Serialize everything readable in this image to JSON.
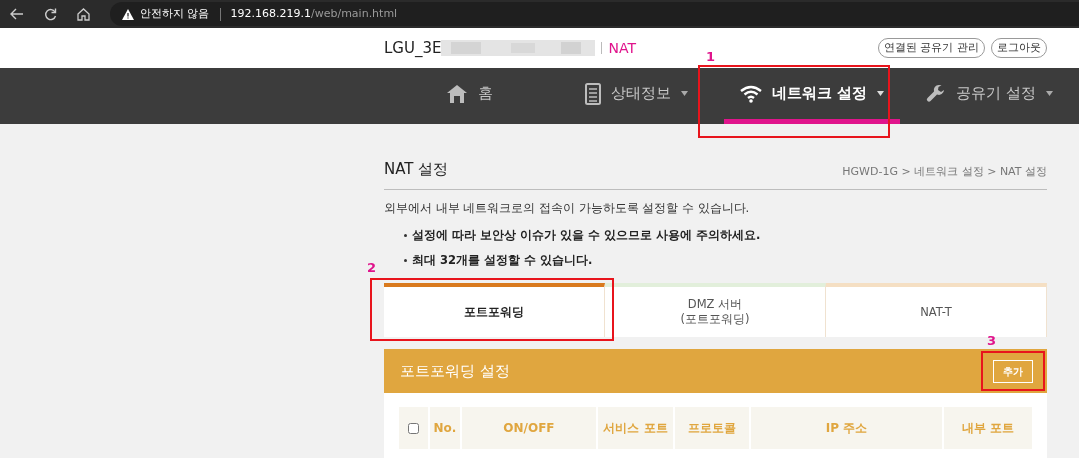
{
  "browser": {
    "security": "안전하지 않음",
    "url_host": "192.168.219.1",
    "url_path": "/web/main.html"
  },
  "header": {
    "ssid": "LGU_3E",
    "mode": "NAT",
    "buttons": [
      "연결된 공유기 관리",
      "로그아웃"
    ]
  },
  "nav": [
    {
      "label": "홈",
      "dropdown": false,
      "selected": false
    },
    {
      "label": "상태정보",
      "dropdown": true,
      "selected": false
    },
    {
      "label": "네트워크 설정",
      "dropdown": true,
      "selected": true
    },
    {
      "label": "공유기 설정",
      "dropdown": true,
      "selected": false
    }
  ],
  "page": {
    "title": "NAT 설정",
    "breadcrumb": "HGWD-1G > 네트워크 설정 > NAT 설정",
    "description": "외부에서 내부 네트워크로의 접속이 가능하도록 설정할 수 있습니다.",
    "notes": [
      "설정에 따라 보안상 이슈가 있을 수 있으므로 사용에 주의하세요.",
      "최대 32개를 설정할 수 있습니다."
    ]
  },
  "tabs": [
    {
      "label": "포트포워딩",
      "selected": true,
      "color": "#d97a1e"
    },
    {
      "label": "DMZ 서버\n(포트포워딩)",
      "selected": false,
      "color": "#e2efdb"
    },
    {
      "label": "NAT-T",
      "selected": false,
      "color": "#f5dfc3"
    }
  ],
  "panel": {
    "title": "포트포워딩 설정",
    "add_button": "추가"
  },
  "table": {
    "select_all_checked": false,
    "columns": [
      "No.",
      "ON/OFF",
      "서비스 포트",
      "프로토콜",
      "IP 주소",
      "내부 포트"
    ]
  },
  "annotations": [
    "1",
    "2",
    "3"
  ]
}
